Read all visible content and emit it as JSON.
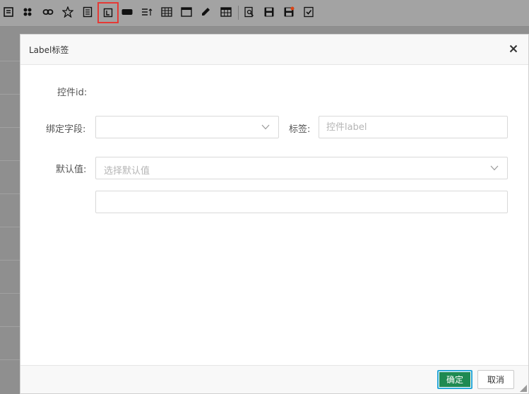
{
  "toolbar": {
    "icons": [
      "form-icon",
      "group-icon",
      "link-icon",
      "star-icon",
      "text-icon",
      "label-icon",
      "button-icon",
      "list-icon",
      "grid-icon",
      "window-icon",
      "edit-icon",
      "table-icon",
      "preview-icon",
      "save-icon",
      "save-as-icon",
      "check-icon"
    ],
    "active_icon": "label-icon"
  },
  "dialog": {
    "title": "Label标签",
    "fields": {
      "control_id_label": "控件id:",
      "bind_field_label": "绑定字段:",
      "bind_field_value": "",
      "tag_label": "标签:",
      "tag_placeholder": "控件label",
      "default_label": "默认值:",
      "default_placeholder": "选择默认值",
      "default_extra_value": ""
    },
    "buttons": {
      "ok": "确定",
      "cancel": "取消"
    }
  },
  "colors": {
    "ok_button": "#1e8a52",
    "ok_border": "#2aa8d8",
    "active_highlight": "#e53935",
    "overlay": "#8f8f8f"
  }
}
